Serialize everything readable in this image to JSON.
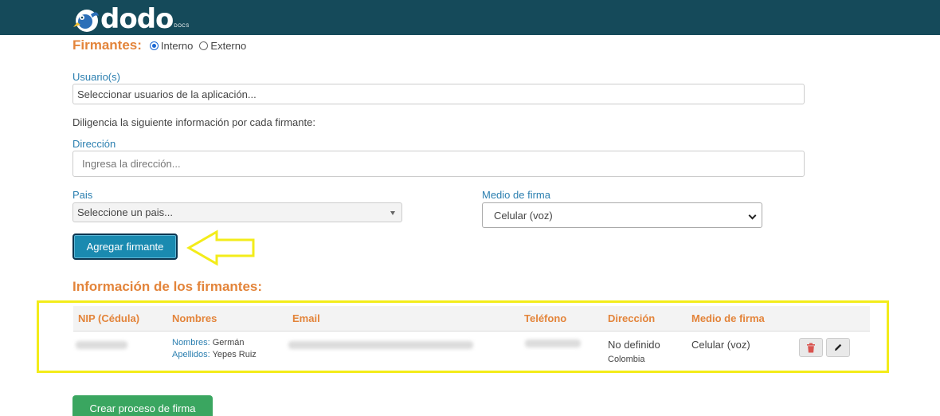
{
  "brand": {
    "logo_text": "dodo",
    "logo_sub": "DOCS"
  },
  "signers": {
    "title": "Firmantes:",
    "options": [
      {
        "label": "Interno",
        "selected": true
      },
      {
        "label": "Externo",
        "selected": false
      }
    ]
  },
  "users": {
    "label": "Usuario(s)",
    "placeholder": "Seleccionar usuarios de la aplicación..."
  },
  "instructions": "Diligencia la siguiente información por cada firmante:",
  "address": {
    "label": "Dirección",
    "placeholder": "Ingresa la dirección..."
  },
  "country": {
    "label": "Pais",
    "placeholder": "Seleccione un pais..."
  },
  "signature_method": {
    "label": "Medio de firma",
    "value": "Celular (voz)"
  },
  "add_button": "Agregar firmante",
  "signers_info": {
    "title": "Información de los firmantes:",
    "columns": [
      "NIP (Cédula)",
      "Nombres",
      "Email",
      "Teléfono",
      "Dirección",
      "Medio de firma"
    ],
    "rows": [
      {
        "names_label": "Nombres:",
        "names_value": "Germán",
        "surnames_label": "Apellidos:",
        "surnames_value": "Yepes Ruiz",
        "address": "No definido",
        "country": "Colombia",
        "method": "Celular (voz)"
      }
    ]
  },
  "create_button": "Crear proceso de firma",
  "colors": {
    "topbar": "#154a5a",
    "accent_orange": "#e3843a",
    "label_blue": "#2b7fb0",
    "highlight_yellow": "#f3ec1a",
    "add_button": "#1a8ab0",
    "create_button": "#3aa660"
  },
  "icons": [
    "trash-icon",
    "pencil-icon",
    "arrow-left-icon",
    "bird-logo-icon"
  ]
}
